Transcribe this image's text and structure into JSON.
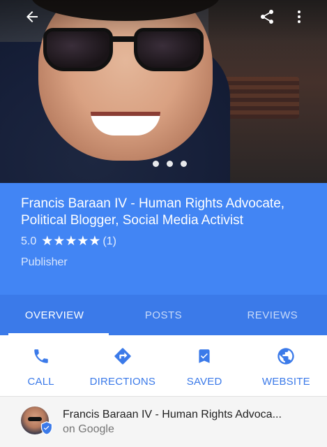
{
  "header": {
    "back_icon": "arrow-back-icon",
    "share_icon": "share-icon",
    "more_icon": "more-vert-icon"
  },
  "carousel": {
    "dots": 3
  },
  "profile": {
    "title": "Francis Baraan IV - Human Rights Advocate, Political Blogger, Social Media Activist",
    "rating_value": "5.0",
    "stars": "★★★★★",
    "rating_count": "(1)",
    "category": "Publisher"
  },
  "tabs": [
    {
      "label": "OVERVIEW",
      "active": true
    },
    {
      "label": "POSTS",
      "active": false
    },
    {
      "label": "REVIEWS",
      "active": false
    }
  ],
  "actions": [
    {
      "label": "CALL",
      "icon": "phone-icon"
    },
    {
      "label": "DIRECTIONS",
      "icon": "directions-icon"
    },
    {
      "label": "SAVED",
      "icon": "bookmark-icon"
    },
    {
      "label": "WEBSITE",
      "icon": "globe-icon"
    }
  ],
  "footer": {
    "name": "Francis Baraan IV - Human Rights Advoca...",
    "subtitle": "on Google"
  },
  "colors": {
    "accent": "#4285f4",
    "tab_bar": "#3b7ae9",
    "link": "#3b7ae9"
  }
}
